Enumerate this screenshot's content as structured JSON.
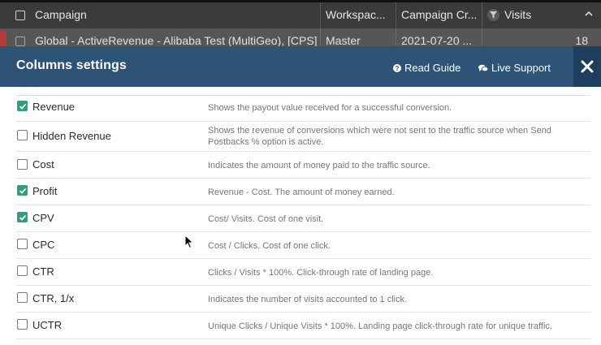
{
  "table": {
    "headers": {
      "campaign": "Campaign",
      "workspace": "Workspac...",
      "created": "Campaign Cr...",
      "visits": "Visits"
    },
    "row": {
      "campaign": "Global - ActiveRevenue - Alibaba Test (MultiGeo), [CPS]",
      "workspace": "Master",
      "created": "2021-07-20 ...",
      "visits": "18"
    }
  },
  "modal": {
    "title": "Columns settings",
    "read_guide": "Read Guide",
    "live_support": "Live Support",
    "accent_color": "#2d5377",
    "check_color": "#2e9e7c",
    "columns": [
      {
        "name": "Revenue",
        "checked": true,
        "description": "Shows the payout value received for a successful conversion."
      },
      {
        "name": "Hidden Revenue",
        "checked": false,
        "description": "Shows the revenue of conversions which were not sent to the traffic source when Send Postbacks % option is active."
      },
      {
        "name": "Cost",
        "checked": false,
        "description": "Indicates the amount of money paid to the traffic source."
      },
      {
        "name": "Profit",
        "checked": true,
        "description": "Revenue - Cost. The amount of money earned."
      },
      {
        "name": "CPV",
        "checked": true,
        "description": "Cost/ Visits. Cost of one visit."
      },
      {
        "name": "CPC",
        "checked": false,
        "description": "Cost / Clicks. Cost of one click."
      },
      {
        "name": "CTR",
        "checked": false,
        "description": "Clicks / Visits * 100%. Click-through rate of landing page."
      },
      {
        "name": "CTR, 1/x",
        "checked": false,
        "description": "Indicates the number of visits accounted to 1 click."
      },
      {
        "name": "UCTR",
        "checked": false,
        "description": "Unique Clicks / Unique Visits * 100%. Landing page click-through rate for unique traffic."
      }
    ]
  }
}
